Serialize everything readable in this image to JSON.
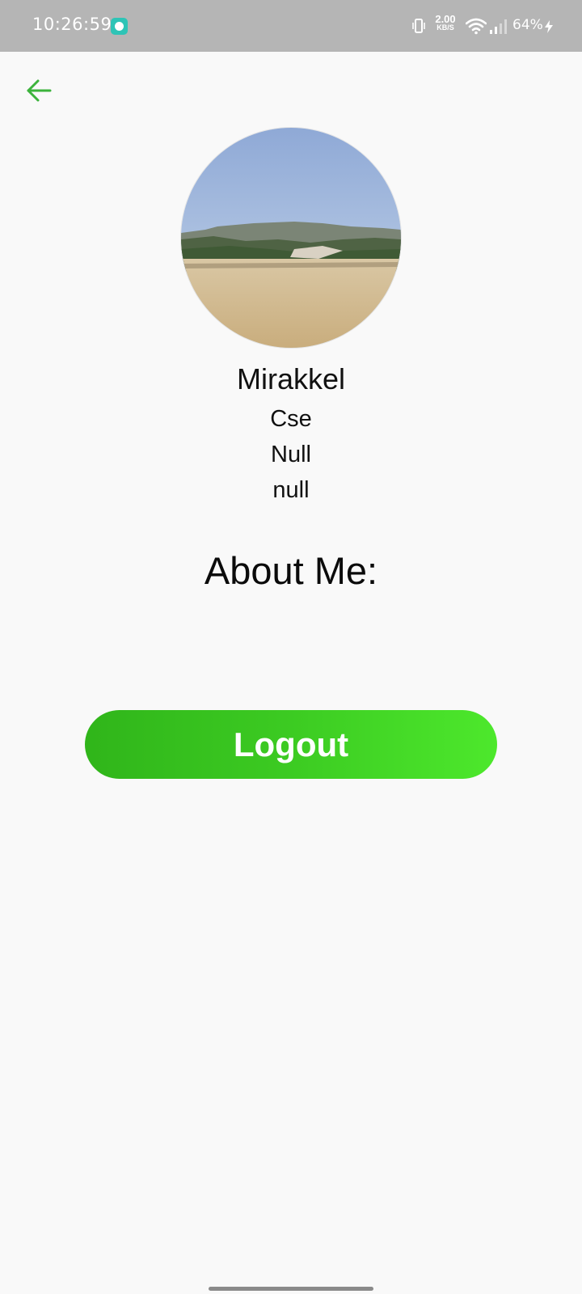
{
  "status_bar": {
    "time": "10:26:59",
    "speed_value": "2.00",
    "speed_unit": "KB/S",
    "battery": "64%",
    "icons": [
      "notification-chat-icon",
      "vibrate-icon",
      "wifi-icon",
      "signal-icon",
      "charging-bolt-icon"
    ]
  },
  "header": {
    "back_icon": "arrow-left-icon",
    "accent_color": "#3cb33c"
  },
  "profile": {
    "name": "Mirakkel",
    "department": "Cse",
    "line2": "Null",
    "line3": "null",
    "about_heading": "About Me:"
  },
  "actions": {
    "logout_label": "Logout",
    "logout_gradient": [
      "#30b51a",
      "#4de82c"
    ]
  }
}
